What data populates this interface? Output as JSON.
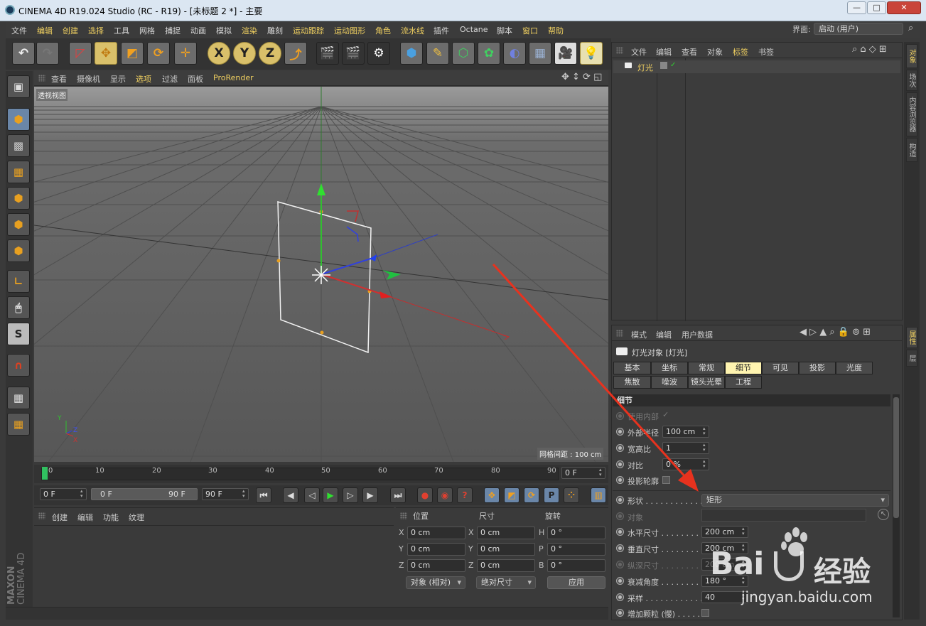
{
  "window": {
    "title": "CINEMA 4D R19.024 Studio (RC - R19) - [未标题 2 *] - 主要",
    "min": "—",
    "max": "□",
    "close": "✕"
  },
  "menu": [
    {
      "label": "文件"
    },
    {
      "label": "编辑"
    },
    {
      "label": "创建"
    },
    {
      "label": "选择"
    },
    {
      "label": "工具"
    },
    {
      "label": "网格"
    },
    {
      "label": "捕捉"
    },
    {
      "label": "动画"
    },
    {
      "label": "模拟"
    },
    {
      "label": "渲染"
    },
    {
      "label": "雕刻"
    },
    {
      "label": "运动跟踪"
    },
    {
      "label": "运动图形"
    },
    {
      "label": "角色"
    },
    {
      "label": "流水线"
    },
    {
      "label": "插件"
    },
    {
      "label": "Octane"
    },
    {
      "label": "脚本"
    },
    {
      "label": "窗口"
    },
    {
      "label": "帮助"
    }
  ],
  "interface": {
    "label": "界面:",
    "value": "启动 (用户)"
  },
  "toolbar": {
    "x": "X",
    "y": "Y",
    "z": "Z"
  },
  "viewport": {
    "menu": [
      "查看",
      "摄像机",
      "显示",
      "选项",
      "过滤",
      "面板",
      "ProRender"
    ],
    "view_name": "透视视图",
    "grid_label": "网格间距 : 100 cm",
    "axis_x": "X",
    "axis_y": "Y",
    "axis_z": "Z"
  },
  "timeline": {
    "ticks": [
      "0",
      "10",
      "20",
      "30",
      "40",
      "50",
      "60",
      "70",
      "80",
      "90"
    ],
    "current": "0 F"
  },
  "playback": {
    "start": "0 F",
    "range_start": "0 F",
    "range_end": "90 F",
    "end": "90 F"
  },
  "materials": {
    "menu": [
      "创建",
      "编辑",
      "功能",
      "纹理"
    ]
  },
  "coords": {
    "headers": {
      "pos": "位置",
      "size": "尺寸",
      "rot": "旋转"
    },
    "rows": [
      {
        "a": "X",
        "pos": "0 cm",
        "b": "X",
        "size": "0 cm",
        "c": "H",
        "rot": "0 °"
      },
      {
        "a": "Y",
        "pos": "0 cm",
        "b": "Y",
        "size": "0 cm",
        "c": "P",
        "rot": "0 °"
      },
      {
        "a": "Z",
        "pos": "0 cm",
        "b": "Z",
        "size": "0 cm",
        "c": "B",
        "rot": "0 °"
      }
    ],
    "mode": "对象 (相对)",
    "size_mode": "绝对尺寸",
    "apply": "应用"
  },
  "objects": {
    "menu": [
      "文件",
      "编辑",
      "查看",
      "对象",
      "标签",
      "书签"
    ],
    "items": [
      {
        "name": "灯光"
      }
    ]
  },
  "attributes": {
    "menu": [
      "模式",
      "编辑",
      "用户数据"
    ],
    "object_title": "灯光对象 [灯光]",
    "tabs_row1": [
      "基本",
      "坐标",
      "常规",
      "细节",
      "可见",
      "投影",
      "光度"
    ],
    "tabs_row2": [
      "焦散",
      "噪波",
      "镜头光晕",
      "工程"
    ],
    "section": "细节",
    "props": {
      "use_inner": "使用内部",
      "outer_radius": {
        "label": "外部半径",
        "value": "100 cm"
      },
      "aspect": {
        "label": "宽高比",
        "value": "1"
      },
      "contrast": {
        "label": "对比",
        "value": "0 %"
      },
      "shadow_caster": "投影轮廓",
      "shape": {
        "label": "形状 . . . . . . . . . . . .",
        "value": "矩形"
      },
      "object": "对象",
      "h_size": {
        "label": "水平尺寸 . . . . . . . . . .",
        "value": "200 cm"
      },
      "v_size": {
        "label": "垂直尺寸 . . . . . . . . . .",
        "value": "200 cm"
      },
      "depth": {
        "label": "纵深尺寸 . . . . . . . . . .",
        "value": "200 cm"
      },
      "falloff_angle": {
        "label": "衰减角度 . . . . . . . . . .",
        "value": "180 °"
      },
      "samples": {
        "label": "采样 . . . . . . . . . . . .",
        "value": "40"
      },
      "add_grain": "增加颗粒 (慢) . . . . . . ."
    }
  },
  "right_tabs": [
    "对象",
    "场次",
    "内容浏览器",
    "构造"
  ],
  "right_tabs2": [
    "属性",
    "层"
  ],
  "branding": {
    "maxon": "MAXON",
    "c4d": "CINEMA 4D"
  },
  "watermark": {
    "brand": "Bai",
    "cn": "经验",
    "url": "jingyan.baidu.com"
  },
  "colors": {
    "accent": "#f0d060",
    "arrow": "#e8321e",
    "tab_active": "#fff4b0"
  }
}
